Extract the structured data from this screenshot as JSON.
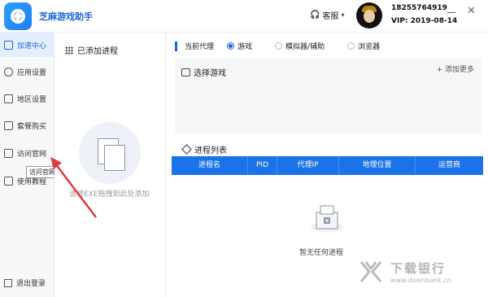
{
  "app": {
    "title": "芝麻游戏助手"
  },
  "header": {
    "support_label": "客服",
    "support_arrow": "▾",
    "user_phone": "18255764919",
    "user_vip": "VIP: 2019-08-14",
    "minimize_label": "",
    "close_label": "✕"
  },
  "sidebar": {
    "items": [
      {
        "label": "加速中心",
        "icon": "gamepad-icon",
        "active": true
      },
      {
        "label": "应用设置",
        "icon": "settings-icon"
      },
      {
        "label": "地区设置",
        "icon": "region-icon"
      },
      {
        "label": "套餐购买",
        "icon": "cart-icon"
      },
      {
        "label": "访问官网",
        "icon": "home-icon"
      },
      {
        "label": "使用教程",
        "icon": "book-icon"
      }
    ],
    "tooltip": "访问官网",
    "logout_label": "退出登录"
  },
  "middle": {
    "title": "已添加进程",
    "drop_hint": "请将EXE拖拽到此处添加"
  },
  "proxy": {
    "title": "当前代理",
    "options": [
      {
        "label": "游戏",
        "selected": true
      },
      {
        "label": "模拟器/辅助",
        "selected": false
      },
      {
        "label": "浏览器",
        "selected": false
      }
    ]
  },
  "select_game": {
    "title": "选择游戏",
    "add_more": "+ 添加更多"
  },
  "process_list": {
    "title": "进程列表",
    "columns": [
      "进程名",
      "PID",
      "代理IP",
      "地理位置",
      "运营商"
    ],
    "empty_text": "暂无任何进程"
  },
  "watermark": {
    "main": "下载银行",
    "sub": "www.downbank.cn"
  },
  "colors": {
    "accent": "#1a73e8",
    "annotation_arrow": "#e0393e"
  }
}
